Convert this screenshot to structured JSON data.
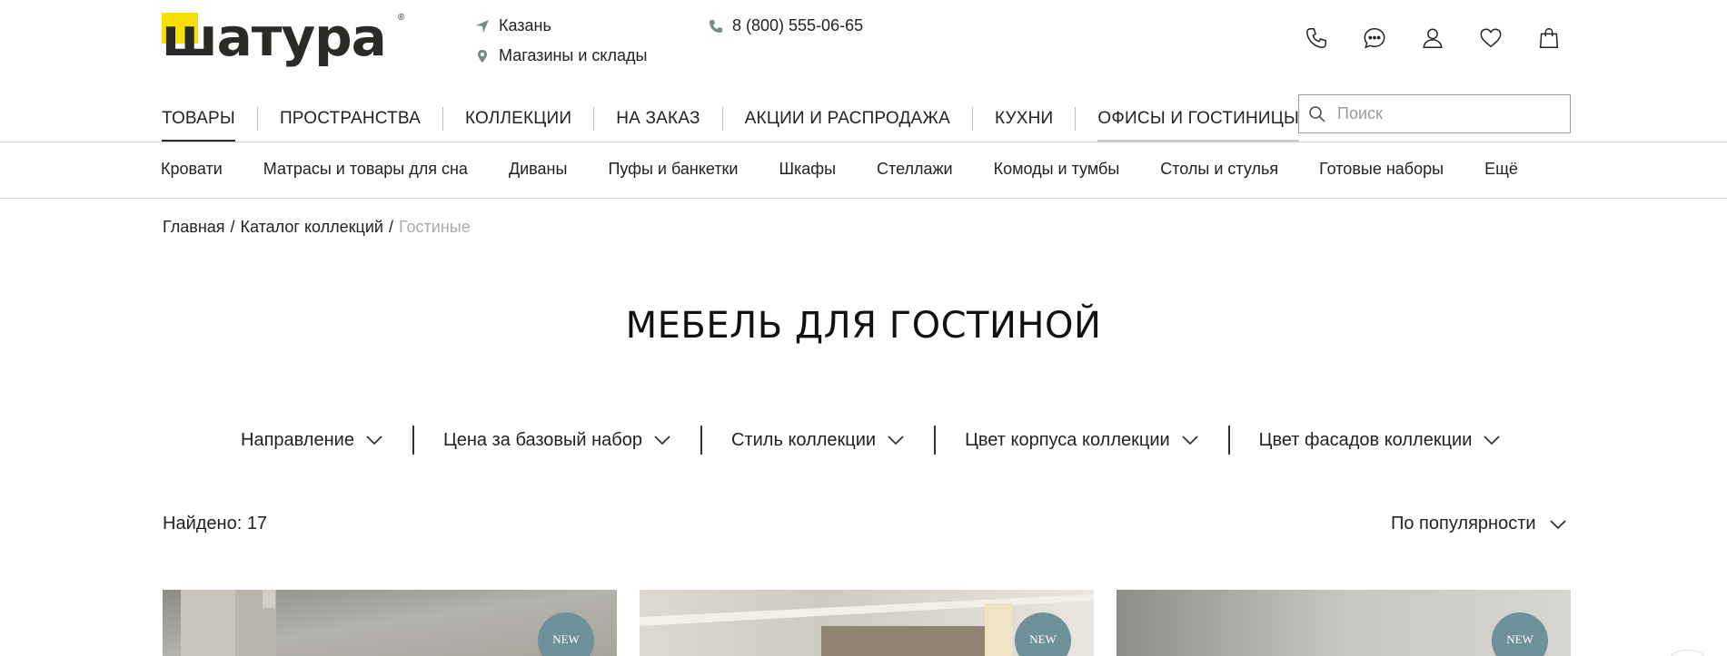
{
  "header": {
    "logo_text": "шатура",
    "logo_reg": "®",
    "city": "Казань",
    "stores": "Магазины и склады",
    "phone": "8 (800) 555-06-65",
    "icons": [
      "phone-icon",
      "chat-icon",
      "user-icon",
      "heart-icon",
      "bag-icon"
    ]
  },
  "mainnav": {
    "items": [
      "ТОВАРЫ",
      "ПРОСТРАНСТВА",
      "КОЛЛЕКЦИИ",
      "НА ЗАКАЗ",
      "АКЦИИ И РАСПРОДАЖА",
      "КУХНИ",
      "ОФИСЫ И ГОСТИНИЦЫ"
    ],
    "active": "ТОВАРЫ"
  },
  "search": {
    "placeholder": "Поиск"
  },
  "subnav": {
    "items": [
      "Кровати",
      "Матрасы и товары для сна",
      "Диваны",
      "Пуфы и банкетки",
      "Шкафы",
      "Стеллажи",
      "Комоды и тумбы",
      "Столы и стулья",
      "Готовые наборы",
      "Ещё"
    ]
  },
  "breadcrumb": {
    "items": [
      "Главная",
      "/",
      "Каталог коллекций",
      "/",
      "Гостиные"
    ]
  },
  "page": {
    "title": "МЕБЕЛЬ ДЛЯ ГОСТИНОЙ"
  },
  "filters": [
    "Направление",
    "Цена за базовый набор",
    "Стиль коллекции",
    "Цвет корпуса коллекции",
    "Цвет фасадов коллекции"
  ],
  "results": {
    "found": "Найдено: 17",
    "sort": "По популярности"
  },
  "cards": [
    {
      "badge": "NEW"
    },
    {
      "badge": "NEW"
    },
    {
      "badge": "NEW"
    }
  ],
  "colors": {
    "logo_yellow": "#f5e000",
    "badge": "#6e9098",
    "text": "#222222",
    "muted": "#aaaaaa"
  }
}
